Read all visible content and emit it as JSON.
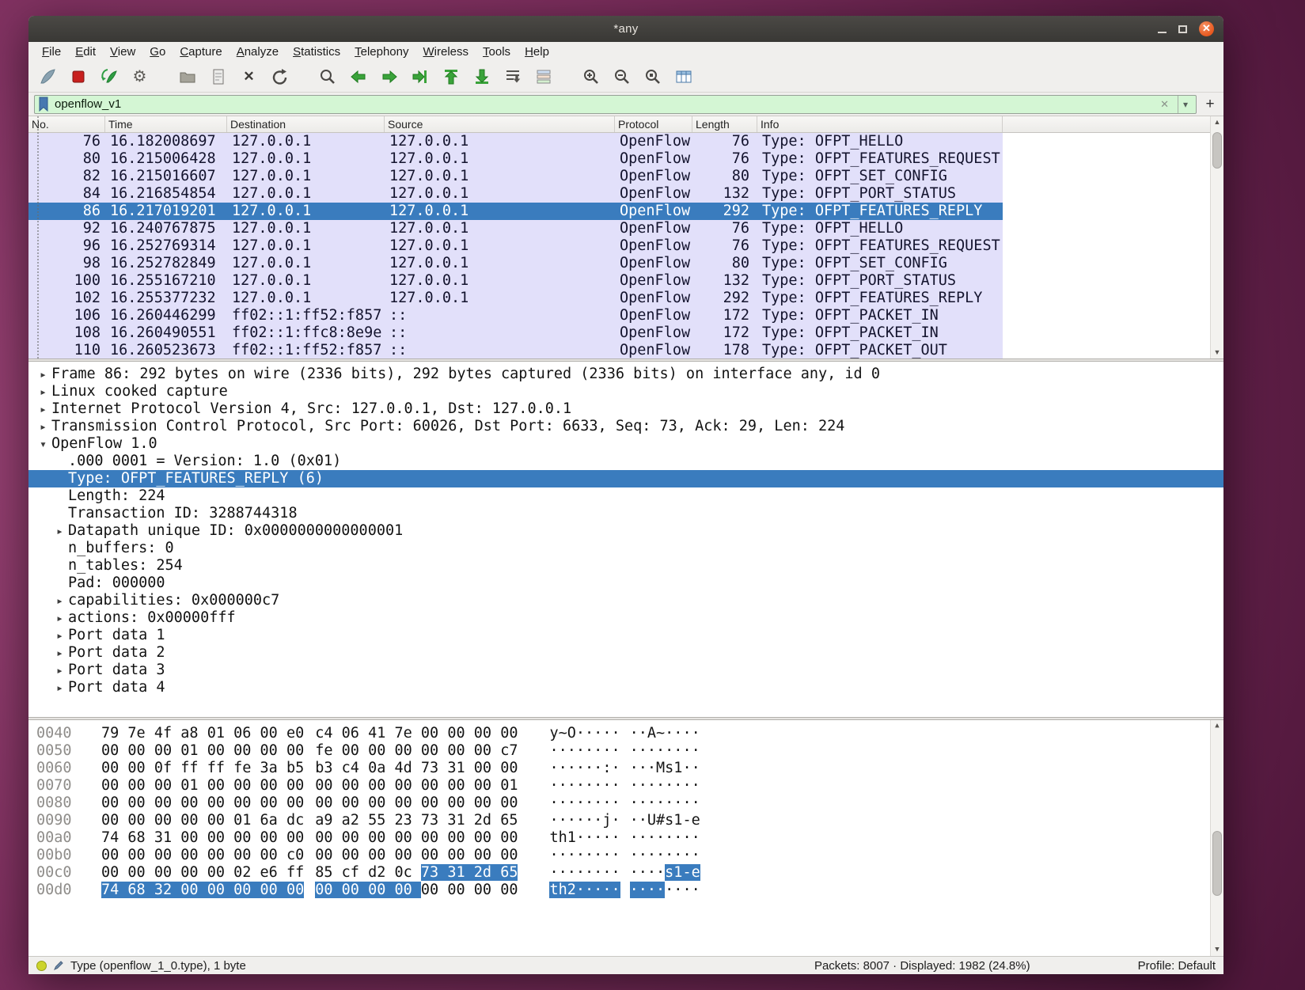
{
  "window": {
    "title": "*any"
  },
  "menu": {
    "items": [
      "File",
      "Edit",
      "View",
      "Go",
      "Capture",
      "Analyze",
      "Statistics",
      "Telephony",
      "Wireless",
      "Tools",
      "Help"
    ]
  },
  "toolbar": {
    "icons": [
      "capture-start",
      "capture-stop",
      "capture-restart",
      "capture-options",
      "open-file",
      "save-file",
      "close-file",
      "reload",
      "find-packet",
      "go-back",
      "go-forward",
      "go-to-packet",
      "go-first-packet",
      "go-last-packet",
      "auto-scroll",
      "colorize",
      "zoom-in",
      "zoom-out",
      "zoom-reset",
      "resize-columns"
    ]
  },
  "filter": {
    "value": "openflow_v1",
    "add_button": "+"
  },
  "packet_list": {
    "columns": [
      "No.",
      "Time",
      "Destination",
      "Source",
      "Protocol",
      "Length",
      "Info"
    ],
    "rows": [
      {
        "no": "76",
        "time": "16.182008697",
        "dest": "127.0.0.1",
        "src": "127.0.0.1",
        "proto": "OpenFlow",
        "len": "76",
        "info": "Type: OFPT_HELLO",
        "selected": false
      },
      {
        "no": "80",
        "time": "16.215006428",
        "dest": "127.0.0.1",
        "src": "127.0.0.1",
        "proto": "OpenFlow",
        "len": "76",
        "info": "Type: OFPT_FEATURES_REQUEST",
        "selected": false
      },
      {
        "no": "82",
        "time": "16.215016607",
        "dest": "127.0.0.1",
        "src": "127.0.0.1",
        "proto": "OpenFlow",
        "len": "80",
        "info": "Type: OFPT_SET_CONFIG",
        "selected": false
      },
      {
        "no": "84",
        "time": "16.216854854",
        "dest": "127.0.0.1",
        "src": "127.0.0.1",
        "proto": "OpenFlow",
        "len": "132",
        "info": "Type: OFPT_PORT_STATUS",
        "selected": false
      },
      {
        "no": "86",
        "time": "16.217019201",
        "dest": "127.0.0.1",
        "src": "127.0.0.1",
        "proto": "OpenFlow",
        "len": "292",
        "info": "Type: OFPT_FEATURES_REPLY",
        "selected": true
      },
      {
        "no": "92",
        "time": "16.240767875",
        "dest": "127.0.0.1",
        "src": "127.0.0.1",
        "proto": "OpenFlow",
        "len": "76",
        "info": "Type: OFPT_HELLO",
        "selected": false
      },
      {
        "no": "96",
        "time": "16.252769314",
        "dest": "127.0.0.1",
        "src": "127.0.0.1",
        "proto": "OpenFlow",
        "len": "76",
        "info": "Type: OFPT_FEATURES_REQUEST",
        "selected": false
      },
      {
        "no": "98",
        "time": "16.252782849",
        "dest": "127.0.0.1",
        "src": "127.0.0.1",
        "proto": "OpenFlow",
        "len": "80",
        "info": "Type: OFPT_SET_CONFIG",
        "selected": false
      },
      {
        "no": "100",
        "time": "16.255167210",
        "dest": "127.0.0.1",
        "src": "127.0.0.1",
        "proto": "OpenFlow",
        "len": "132",
        "info": "Type: OFPT_PORT_STATUS",
        "selected": false
      },
      {
        "no": "102",
        "time": "16.255377232",
        "dest": "127.0.0.1",
        "src": "127.0.0.1",
        "proto": "OpenFlow",
        "len": "292",
        "info": "Type: OFPT_FEATURES_REPLY",
        "selected": false
      },
      {
        "no": "106",
        "time": "16.260446299",
        "dest": "ff02::1:ff52:f857",
        "src": "::",
        "proto": "OpenFlow",
        "len": "172",
        "info": "Type: OFPT_PACKET_IN",
        "selected": false
      },
      {
        "no": "108",
        "time": "16.260490551",
        "dest": "ff02::1:ffc8:8e9e",
        "src": "::",
        "proto": "OpenFlow",
        "len": "172",
        "info": "Type: OFPT_PACKET_IN",
        "selected": false
      },
      {
        "no": "110",
        "time": "16.260523673",
        "dest": "ff02::1:ff52:f857",
        "src": "::",
        "proto": "OpenFlow",
        "len": "178",
        "info": "Type: OFPT_PACKET_OUT",
        "selected": false
      }
    ]
  },
  "details": {
    "lines": [
      {
        "indent": 0,
        "arrow": "collapsed",
        "text": "Frame 86: 292 bytes on wire (2336 bits), 292 bytes captured (2336 bits) on interface any, id 0",
        "selected": false
      },
      {
        "indent": 0,
        "arrow": "collapsed",
        "text": "Linux cooked capture",
        "selected": false
      },
      {
        "indent": 0,
        "arrow": "collapsed",
        "text": "Internet Protocol Version 4, Src: 127.0.0.1, Dst: 127.0.0.1",
        "selected": false
      },
      {
        "indent": 0,
        "arrow": "collapsed",
        "text": "Transmission Control Protocol, Src Port: 60026, Dst Port: 6633, Seq: 73, Ack: 29, Len: 224",
        "selected": false
      },
      {
        "indent": 0,
        "arrow": "expanded",
        "text": "OpenFlow 1.0",
        "selected": false
      },
      {
        "indent": 1,
        "arrow": "none",
        "text": ".000 0001 = Version: 1.0 (0x01)",
        "selected": false
      },
      {
        "indent": 1,
        "arrow": "none",
        "text": "Type: OFPT_FEATURES_REPLY (6)",
        "selected": true
      },
      {
        "indent": 1,
        "arrow": "none",
        "text": "Length: 224",
        "selected": false
      },
      {
        "indent": 1,
        "arrow": "none",
        "text": "Transaction ID: 3288744318",
        "selected": false
      },
      {
        "indent": 1,
        "arrow": "collapsed",
        "text": "Datapath unique ID: 0x0000000000000001",
        "selected": false
      },
      {
        "indent": 1,
        "arrow": "none",
        "text": "n_buffers: 0",
        "selected": false
      },
      {
        "indent": 1,
        "arrow": "none",
        "text": "n_tables: 254",
        "selected": false
      },
      {
        "indent": 1,
        "arrow": "none",
        "text": "Pad: 000000",
        "selected": false
      },
      {
        "indent": 1,
        "arrow": "collapsed",
        "text": "capabilities: 0x000000c7",
        "selected": false
      },
      {
        "indent": 1,
        "arrow": "collapsed",
        "text": "actions: 0x00000fff",
        "selected": false
      },
      {
        "indent": 1,
        "arrow": "collapsed",
        "text": "Port data 1",
        "selected": false
      },
      {
        "indent": 1,
        "arrow": "collapsed",
        "text": "Port data 2",
        "selected": false
      },
      {
        "indent": 1,
        "arrow": "collapsed",
        "text": "Port data 3",
        "selected": false
      },
      {
        "indent": 1,
        "arrow": "collapsed",
        "text": "Port data 4",
        "selected": false
      }
    ]
  },
  "hex": {
    "rows": [
      {
        "offset": "0040",
        "bytes": [
          "79",
          "7e",
          "4f",
          "a8",
          "01",
          "06",
          "00",
          "e0",
          "c4",
          "06",
          "41",
          "7e",
          "00",
          "00",
          "00",
          "00"
        ],
        "ascii": "y~O·······A~····",
        "sel": null
      },
      {
        "offset": "0050",
        "bytes": [
          "00",
          "00",
          "00",
          "01",
          "00",
          "00",
          "00",
          "00",
          "fe",
          "00",
          "00",
          "00",
          "00",
          "00",
          "00",
          "c7"
        ],
        "ascii": "················",
        "sel": null
      },
      {
        "offset": "0060",
        "bytes": [
          "00",
          "00",
          "0f",
          "ff",
          "ff",
          "fe",
          "3a",
          "b5",
          "b3",
          "c4",
          "0a",
          "4d",
          "73",
          "31",
          "00",
          "00"
        ],
        "ascii": "······:····Ms1··",
        "sel": null
      },
      {
        "offset": "0070",
        "bytes": [
          "00",
          "00",
          "00",
          "01",
          "00",
          "00",
          "00",
          "00",
          "00",
          "00",
          "00",
          "00",
          "00",
          "00",
          "00",
          "01"
        ],
        "ascii": "················",
        "sel": null
      },
      {
        "offset": "0080",
        "bytes": [
          "00",
          "00",
          "00",
          "00",
          "00",
          "00",
          "00",
          "00",
          "00",
          "00",
          "00",
          "00",
          "00",
          "00",
          "00",
          "00"
        ],
        "ascii": "················",
        "sel": null
      },
      {
        "offset": "0090",
        "bytes": [
          "00",
          "00",
          "00",
          "00",
          "00",
          "01",
          "6a",
          "dc",
          "a9",
          "a2",
          "55",
          "23",
          "73",
          "31",
          "2d",
          "65"
        ],
        "ascii": "······j···U#s1-e",
        "sel": null
      },
      {
        "offset": "00a0",
        "bytes": [
          "74",
          "68",
          "31",
          "00",
          "00",
          "00",
          "00",
          "00",
          "00",
          "00",
          "00",
          "00",
          "00",
          "00",
          "00",
          "00"
        ],
        "ascii": "th1·············",
        "sel": null
      },
      {
        "offset": "00b0",
        "bytes": [
          "00",
          "00",
          "00",
          "00",
          "00",
          "00",
          "00",
          "c0",
          "00",
          "00",
          "00",
          "00",
          "00",
          "00",
          "00",
          "00"
        ],
        "ascii": "················",
        "sel": null
      },
      {
        "offset": "00c0",
        "bytes": [
          "00",
          "00",
          "00",
          "00",
          "00",
          "02",
          "e6",
          "ff",
          "85",
          "cf",
          "d2",
          "0c",
          "73",
          "31",
          "2d",
          "65"
        ],
        "ascii": "············s1-e",
        "sel": [
          12,
          15
        ]
      },
      {
        "offset": "00d0",
        "bytes": [
          "74",
          "68",
          "32",
          "00",
          "00",
          "00",
          "00",
          "00",
          "00",
          "00",
          "00",
          "00",
          "00",
          "00",
          "00",
          "00"
        ],
        "ascii": "th2·············",
        "sel": [
          0,
          11
        ]
      }
    ]
  },
  "status": {
    "field_info": "Type (openflow_1_0.type), 1 byte",
    "packets": "Packets: 8007 · Displayed: 1982 (24.8%)",
    "profile": "Profile: Default"
  },
  "colors": {
    "selection": "#3a7cbe",
    "openflow_row": "#e2e0fa",
    "filter_valid": "#d4f6d4",
    "close_button": "#e9591f"
  }
}
